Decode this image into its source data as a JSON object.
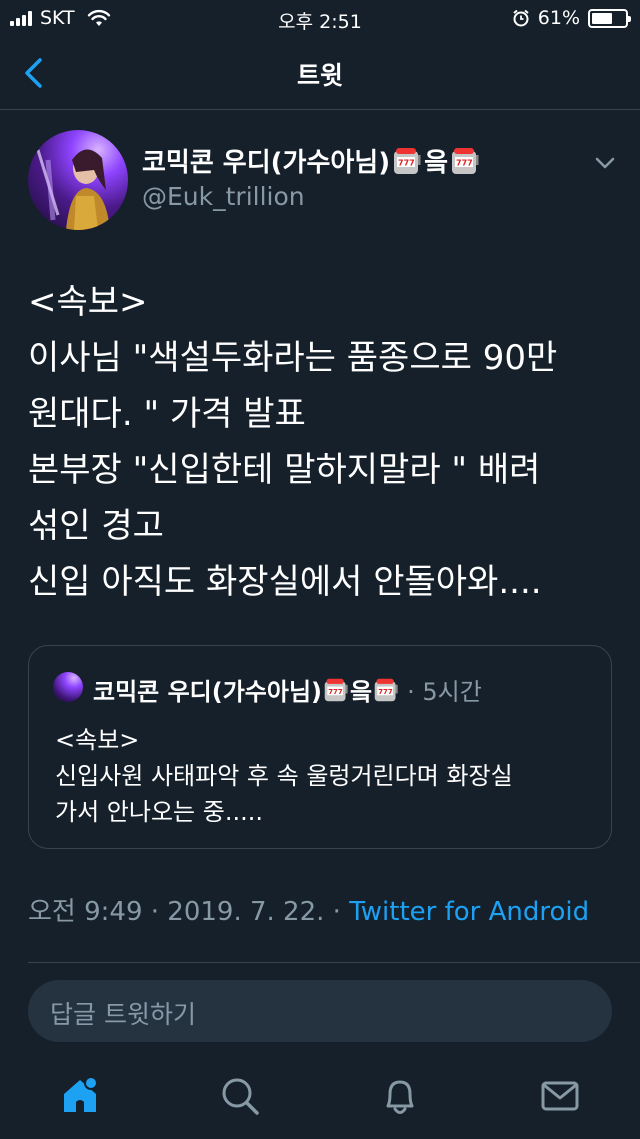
{
  "status_bar": {
    "carrier": "SKT",
    "time": "오후 2:51",
    "battery_percent_label": "61%",
    "battery_level": 0.61
  },
  "header": {
    "title": "트윗"
  },
  "tweet": {
    "author_name": "코믹콘 우디(가수아님)",
    "author_name_suffix": "읔",
    "author_handle": "@Euk_trillion",
    "text_lines": [
      "<속보>",
      "이사님 \"색설두화라는 품종으로 90만",
      "원대다. \" 가격 발표",
      "본부장 \"신입한테 말하지말라 \" 배려",
      "섞인 경고",
      "신입 아직도 화장실에서 안돌아와...."
    ],
    "meta_time": "오전 9:49 · 2019. 7. 22. · ",
    "source": "Twitter for Android"
  },
  "quoted_tweet": {
    "author_name": "코믹콘 우디(가수아님)",
    "author_name_suffix": "읔",
    "time": "· 5시간",
    "text_lines": [
      "<속보>",
      "신입사원 사태파악 후 속 울렁거린다며 화장실",
      "가서 안나오는 중....."
    ]
  },
  "reply": {
    "placeholder": "답글 트윗하기"
  },
  "tab_bar": {
    "tabs": [
      "home-icon",
      "search-icon",
      "notifications-icon",
      "messages-icon"
    ]
  },
  "colors": {
    "background": "#15202b",
    "accent": "#1da1f2",
    "secondary_text": "#8899a6",
    "border": "#38444d"
  }
}
